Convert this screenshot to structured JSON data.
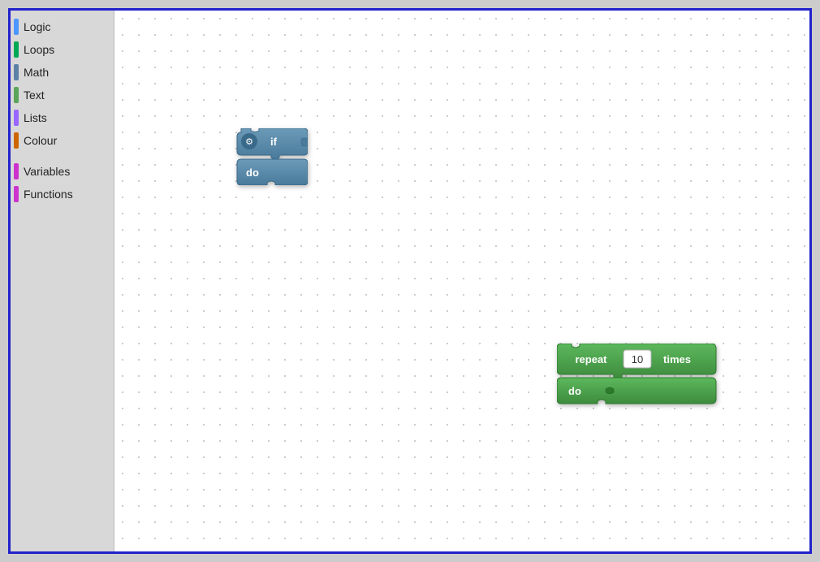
{
  "sidebar": {
    "items": [
      {
        "id": "logic",
        "label": "Logic",
        "color": "#4c97ff"
      },
      {
        "id": "loops",
        "label": "Loops",
        "color": "#00aa55"
      },
      {
        "id": "math",
        "label": "Math",
        "color": "#5c81a6"
      },
      {
        "id": "text",
        "label": "Text",
        "color": "#5ba55b"
      },
      {
        "id": "lists",
        "label": "Lists",
        "color": "#9966ff"
      },
      {
        "id": "colour",
        "label": "Colour",
        "color": "#cc6600"
      },
      {
        "id": "variables",
        "label": "Variables",
        "color": "#cc33cc"
      },
      {
        "id": "functions",
        "label": "Functions",
        "color": "#cc33cc"
      }
    ]
  },
  "blocks": {
    "if_block": {
      "gear_icon": "⚙",
      "if_label": "if",
      "do_label": "do"
    },
    "repeat_block": {
      "repeat_label": "repeat",
      "value": "10",
      "times_label": "times",
      "do_label": "do"
    }
  }
}
